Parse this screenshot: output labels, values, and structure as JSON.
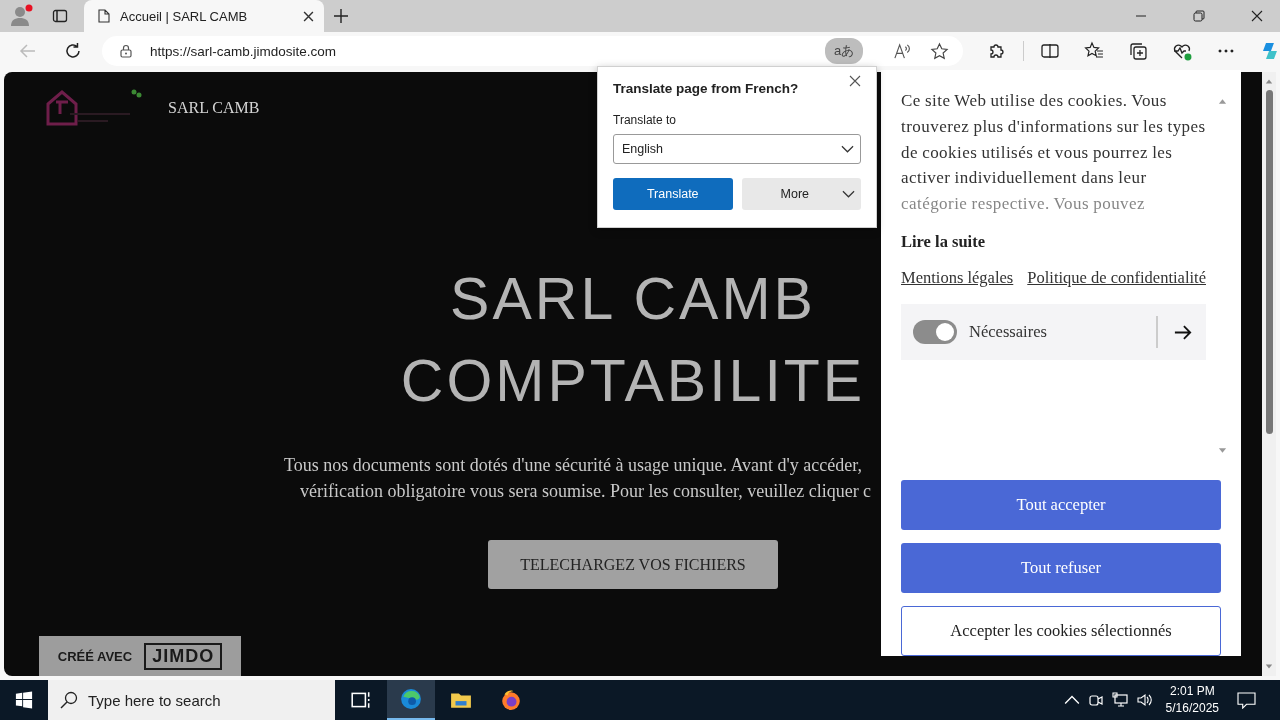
{
  "browser": {
    "tab": {
      "title": "Accueil | SARL CAMB",
      "selected": true
    },
    "url": "https://sarl-camb.jimdosite.com",
    "translate_chip": "aあ",
    "back_disabled": true
  },
  "translate_popup": {
    "title": "Translate page from French?",
    "label": "Translate to",
    "language": "English",
    "buttons": [
      {
        "label": "Translate",
        "kind": "primary"
      },
      {
        "label": "More",
        "kind": "menu"
      }
    ]
  },
  "site": {
    "brand": "SARL CAMB",
    "hero_title": [
      "SARL CAMB",
      "COMPTABILITE"
    ],
    "hero_text": [
      "Tous nos documents sont dotés d'une sécurité à usage unique. Avant d'y accéder,",
      "vérification obligatoire vous sera soumise. Pour les consulter, veuillez cliquer c"
    ],
    "cta": "TELECHARGEZ VOS FICHIERS",
    "badge": {
      "prefix": "CRÉÉ AVEC",
      "brand": "JIMDO"
    }
  },
  "cookie_panel": {
    "text": "Ce site Web utilise des cookies. Vous trouverez plus d'informations sur les types de cookies utilisés et vous pourrez les activer individuellement dans leur catégorie respective. Vous pouvez",
    "read_more": "Lire la suite",
    "links": [
      "Mentions légales",
      "Politique de confidentialité"
    ],
    "categories": [
      {
        "label": "Nécessaires",
        "on": true
      }
    ],
    "buttons": [
      {
        "label": "Tout accepter",
        "kind": "filled"
      },
      {
        "label": "Tout refuser",
        "kind": "filled"
      },
      {
        "label": "Accepter les cookies sélectionnés",
        "kind": "outline"
      }
    ]
  },
  "taskbar": {
    "search_placeholder": "Type here to search",
    "apps": [
      {
        "kind": "task-view",
        "selected": false
      },
      {
        "kind": "edge",
        "selected": true
      },
      {
        "kind": "explorer",
        "selected": false
      },
      {
        "kind": "firefox",
        "selected": false
      }
    ],
    "time": "2:01 PM",
    "date": "5/16/2025"
  }
}
